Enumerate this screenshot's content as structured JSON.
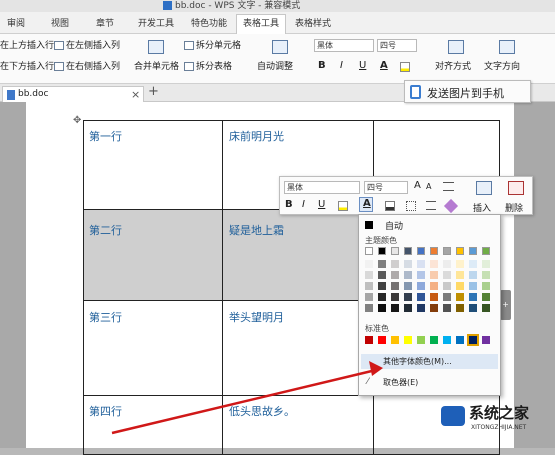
{
  "window": {
    "title": "bb.doc - WPS 文字 - 兼容模式"
  },
  "menu_tabs": [
    {
      "label": "审阅",
      "active": false
    },
    {
      "label": "视图",
      "active": false
    },
    {
      "label": "章节",
      "active": false
    },
    {
      "label": "开发工具",
      "active": false
    },
    {
      "label": "特色功能",
      "active": false
    },
    {
      "label": "表格工具",
      "active": true
    },
    {
      "label": "表格样式",
      "active": false
    }
  ],
  "ribbon": {
    "insert_above": "在上方插入行",
    "insert_left": "在左侧插入列",
    "insert_below": "在下方插入行",
    "insert_right": "在右侧插入列",
    "merge_cells": "合并单元格",
    "split_cells": "拆分单元格",
    "split_table": "拆分表格",
    "auto_fit": "自动调整",
    "font_name": "黑体",
    "font_size": "四号",
    "align": "对齐方式",
    "text_direction": "文字方向",
    "bold": "B",
    "italic": "I",
    "underline": "U",
    "font_color": "A"
  },
  "tabs": {
    "doc_tab": "bb.doc",
    "close": "×",
    "add": "+"
  },
  "send_button": {
    "label": "发送图片到手机"
  },
  "table": {
    "rows": [
      {
        "c1": "第一行",
        "c2": "床前明月光"
      },
      {
        "c1": "第二行",
        "c2": "疑是地上霜"
      },
      {
        "c1": "第三行",
        "c2": "举头望明月"
      },
      {
        "c1": "第四行",
        "c2": "低头思故乡。"
      }
    ]
  },
  "mini_toolbar": {
    "font_name": "黑体",
    "font_size": "四号",
    "grow": "A",
    "shrink": "A",
    "insert": "插入",
    "delete": "删除",
    "bold": "B",
    "italic": "I",
    "underline": "U",
    "font_color": "A"
  },
  "color_palette": {
    "auto_label": "自动",
    "theme_label": "主题颜色",
    "standard_label": "标准色",
    "more_colors": "其他字体颜色(M)...",
    "picker": "取色器(E)",
    "theme_top": [
      "#ffffff",
      "#000000",
      "#e7e6e6",
      "#44546a",
      "#4472c4",
      "#ed7d31",
      "#a5a5a5",
      "#ffc000",
      "#5b9bd5",
      "#70ad47"
    ],
    "theme_shades": [
      [
        "#f2f2f2",
        "#7f7f7f",
        "#d0cece",
        "#d6dce4",
        "#d9e1f2",
        "#fce4d6",
        "#ededed",
        "#fff2cc",
        "#ddebf7",
        "#e2efda"
      ],
      [
        "#d9d9d9",
        "#595959",
        "#aeaaaa",
        "#adb9ca",
        "#b4c6e7",
        "#f8cbad",
        "#dbdbdb",
        "#ffe699",
        "#bdd7ee",
        "#c6e0b4"
      ],
      [
        "#bfbfbf",
        "#404040",
        "#757171",
        "#8497b0",
        "#8ea9db",
        "#f4b084",
        "#c9c9c9",
        "#ffd966",
        "#9bc2e6",
        "#a9d08e"
      ],
      [
        "#a6a6a6",
        "#262626",
        "#3a3838",
        "#333f4f",
        "#2f5597",
        "#c65911",
        "#7b7b7b",
        "#bf8f00",
        "#2e75b6",
        "#548235"
      ],
      [
        "#808080",
        "#0d0d0d",
        "#161616",
        "#222b35",
        "#203864",
        "#833c0b",
        "#525252",
        "#806000",
        "#1f4e78",
        "#375623"
      ]
    ],
    "standard": [
      "#c00000",
      "#ff0000",
      "#ffc000",
      "#ffff00",
      "#92d050",
      "#00b050",
      "#00b0f0",
      "#0070c0",
      "#002060",
      "#7030a0"
    ]
  },
  "watermark": {
    "title": "系统之家",
    "url": "XITONGZHIJIA.NET"
  }
}
